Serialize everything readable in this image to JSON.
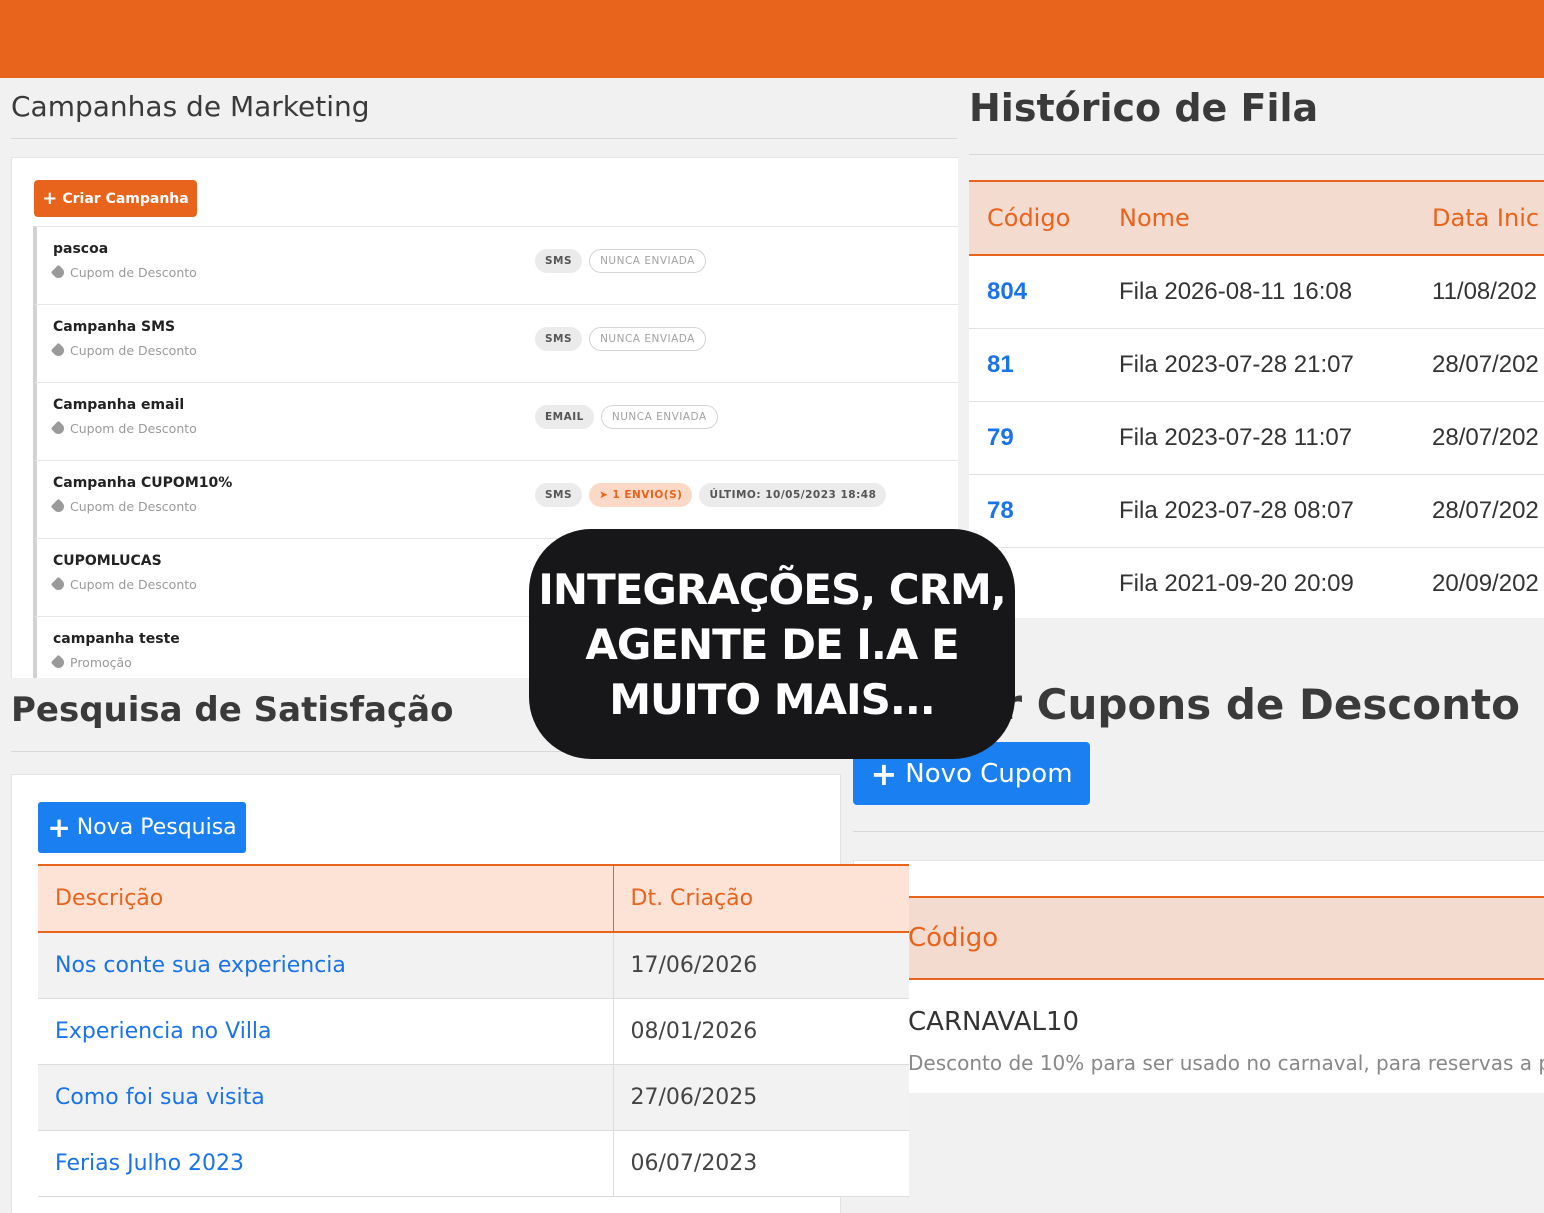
{
  "campanhas": {
    "title": "Campanhas de Marketing",
    "create_button": "Criar Campanha",
    "items": [
      {
        "name": "pascoa",
        "category": "Cupom de Desconto",
        "type": "SMS",
        "status": "NUNCA ENVIADA"
      },
      {
        "name": "Campanha SMS",
        "category": "Cupom de Desconto",
        "type": "SMS",
        "status": "NUNCA ENVIADA"
      },
      {
        "name": "Campanha email",
        "category": "Cupom de Desconto",
        "type": "EMAIL",
        "status": "NUNCA ENVIADA"
      },
      {
        "name": "Campanha CUPOM10%",
        "category": "Cupom de Desconto",
        "type": "SMS",
        "sent": "1 ENVIO(S)",
        "last": "ÚLTIMO: 10/05/2023 18:48"
      },
      {
        "name": "CUPOMLUCAS",
        "category": "Cupom de Desconto"
      },
      {
        "name": "campanha teste",
        "category": "Promoção"
      }
    ]
  },
  "historico": {
    "title": "Histórico de Fila",
    "columns": [
      "Código",
      "Nome",
      "Data Inic"
    ],
    "rows": [
      {
        "code": "804",
        "name": "Fila 2026-08-11 16:08",
        "date": "11/08/202"
      },
      {
        "code": "81",
        "name": "Fila 2023-07-28 21:07",
        "date": "28/07/202"
      },
      {
        "code": "79",
        "name": "Fila 2023-07-28 11:07",
        "date": "28/07/202"
      },
      {
        "code": "78",
        "name": "Fila 2023-07-28 08:07",
        "date": "28/07/202"
      },
      {
        "code": "",
        "name": "Fila 2021-09-20 20:09",
        "date": "20/09/202"
      }
    ]
  },
  "cupons": {
    "title": "ar Cupons de Desconto",
    "new_button": "Novo Cupom",
    "column": "Código",
    "code": "CARNAVAL10",
    "description": "Desconto de 10% para ser usado no carnaval, para reservas a p"
  },
  "pesquisa": {
    "title": "Pesquisa de Satisfação",
    "new_button": "Nova Pesquisa",
    "columns": [
      "Descrição",
      "Dt. Criação"
    ],
    "rows": [
      {
        "desc": "Nos conte sua experiencia",
        "date": "17/06/2026"
      },
      {
        "desc": "Experiencia no Villa",
        "date": "08/01/2026"
      },
      {
        "desc": "Como foi sua visita",
        "date": "27/06/2025"
      },
      {
        "desc": "Ferias Julho 2023",
        "date": "06/07/2023"
      }
    ]
  },
  "overlay": {
    "text": "INTEGRAÇÕES, CRM,\nAGENTE DE I.A E\nMUITO MAIS..."
  },
  "colors": {
    "brand_orange": "#e8631c",
    "link_blue": "#1a73e8",
    "button_blue": "#1a7ff0",
    "overlay_dark": "#17171a"
  }
}
